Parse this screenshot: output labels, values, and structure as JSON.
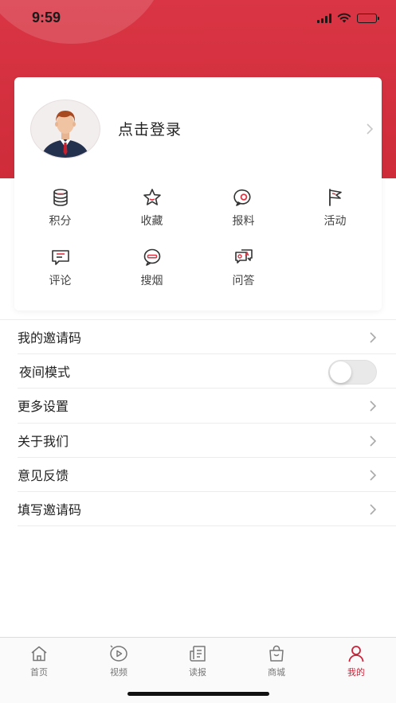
{
  "status_bar": {
    "time": "9:59"
  },
  "profile": {
    "login_label": "点击登录"
  },
  "features": [
    {
      "label": "积分",
      "icon": "database-icon"
    },
    {
      "label": "收藏",
      "icon": "star-icon"
    },
    {
      "label": "报料",
      "icon": "chat-eye-icon"
    },
    {
      "label": "活动",
      "icon": "flag-icon"
    },
    {
      "label": "评论",
      "icon": "comment-icon"
    },
    {
      "label": "搜烟",
      "icon": "search-bubble-icon"
    },
    {
      "label": "问答",
      "icon": "qa-icon"
    }
  ],
  "menu": [
    {
      "label": "我的邀请码"
    },
    {
      "label": "夜间模式",
      "toggle": false
    },
    {
      "label": "更多设置"
    },
    {
      "label": "关于我们"
    },
    {
      "label": "意见反馈"
    },
    {
      "label": "填写邀请码"
    }
  ],
  "tabs": [
    {
      "label": "首页",
      "icon": "home-icon",
      "active": false
    },
    {
      "label": "视频",
      "icon": "video-icon",
      "active": false
    },
    {
      "label": "读报",
      "icon": "newspaper-icon",
      "active": false
    },
    {
      "label": "商城",
      "icon": "shopping-bag-icon",
      "active": false
    },
    {
      "label": "我的",
      "icon": "user-icon",
      "active": true
    }
  ],
  "colors": {
    "brand": "#d93544",
    "active_tab": "#c9243a"
  }
}
